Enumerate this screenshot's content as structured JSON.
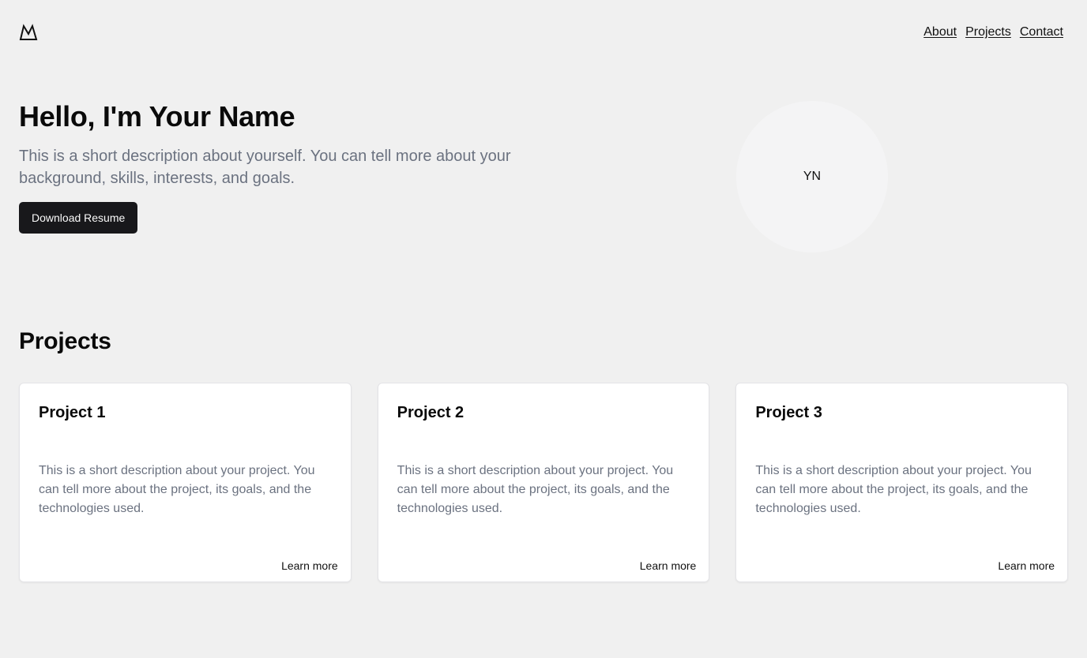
{
  "header": {
    "logo_icon": "mountain-logo-icon",
    "nav": [
      {
        "label": "About"
      },
      {
        "label": "Projects"
      },
      {
        "label": "Contact"
      }
    ]
  },
  "hero": {
    "title": "Hello, I'm Your Name",
    "description": "This is a short description about yourself. You can tell more about your background, skills, interests, and goals.",
    "resume_button": "Download Resume",
    "avatar_initials": "YN"
  },
  "projects": {
    "heading": "Projects",
    "items": [
      {
        "title": "Project 1",
        "description": "This is a short description about your project. You can tell more about the project, its goals, and the technologies used.",
        "link": "Learn more"
      },
      {
        "title": "Project 2",
        "description": "This is a short description about your project. You can tell more about the project, its goals, and the technologies used.",
        "link": "Learn more"
      },
      {
        "title": "Project 3",
        "description": "This is a short description about your project. You can tell more about the project, its goals, and the technologies used.",
        "link": "Learn more"
      }
    ]
  },
  "colors": {
    "background": "#f0f0f0",
    "button": "#18181b",
    "muted_text": "#6b7280",
    "card": "#ffffff"
  }
}
